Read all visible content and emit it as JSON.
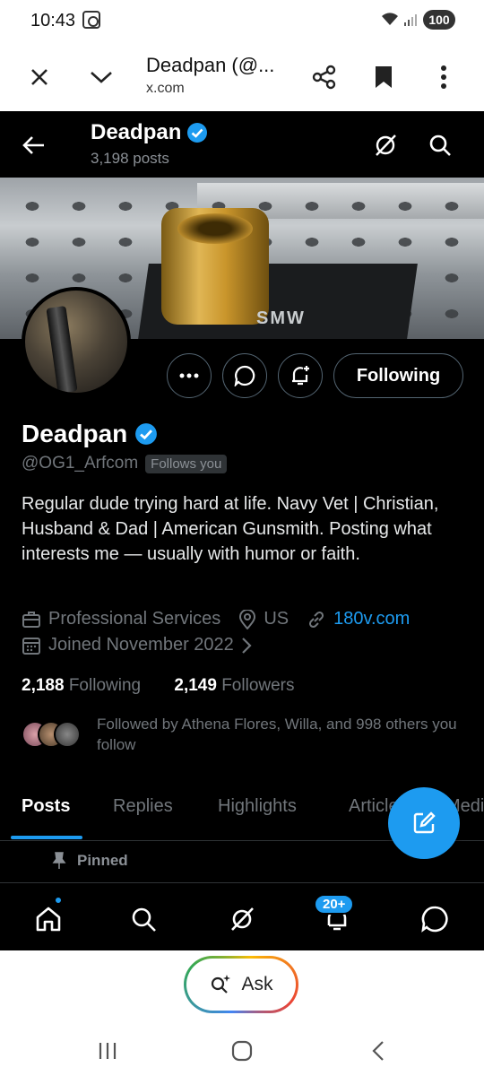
{
  "status": {
    "time": "10:43",
    "battery": "100"
  },
  "browser": {
    "title": "Deadpan (@...",
    "url": "x.com"
  },
  "profile_header": {
    "name": "Deadpan",
    "posts": "3,198 posts"
  },
  "banner": {
    "stamp": "SMW"
  },
  "actions": {
    "following_label": "Following"
  },
  "profile": {
    "name": "Deadpan",
    "handle": "@OG1_Arfcom",
    "follows_you": "Follows you",
    "bio": "Regular dude trying hard at life. Navy Vet | Christian, Husband & Dad | American Gunsmith. Posting what interests me — usually with humor or faith.",
    "category": "Professional Services",
    "location": "US",
    "website": "180v.com",
    "joined": "Joined November 2022",
    "following_count": "2,188",
    "following_label": "Following",
    "followers_count": "2,149",
    "followers_label": "Followers",
    "followed_by": "Followed by Athena Flores, Willa, and 998 others you follow"
  },
  "tabs": [
    "Posts",
    "Replies",
    "Highlights",
    "Articles",
    "Media"
  ],
  "pinned_label": "Pinned",
  "nav": {
    "notifications_badge": "20+"
  },
  "assistant": {
    "label": "Ask"
  },
  "colors": {
    "accent": "#1d9bf0",
    "background": "#000000",
    "muted": "#71767b"
  }
}
